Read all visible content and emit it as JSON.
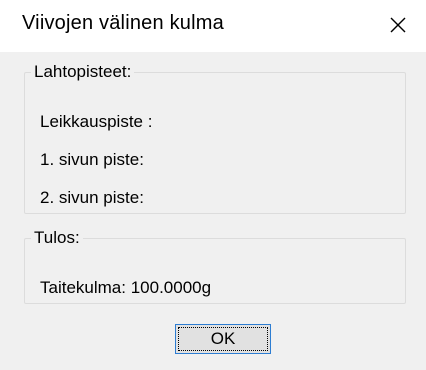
{
  "window": {
    "title": "Viivojen välinen kulma",
    "close_icon": "close-icon"
  },
  "group_points": {
    "legend": "Lahtopisteet:",
    "intersection_label": "Leikkauspiste :",
    "side1_label": "1. sivun piste:",
    "side2_label": "2. sivun piste:"
  },
  "group_result": {
    "legend": "Tulos:",
    "angle_text": "Taitekulma: 100.0000g"
  },
  "buttons": {
    "ok_label": "OK"
  }
}
